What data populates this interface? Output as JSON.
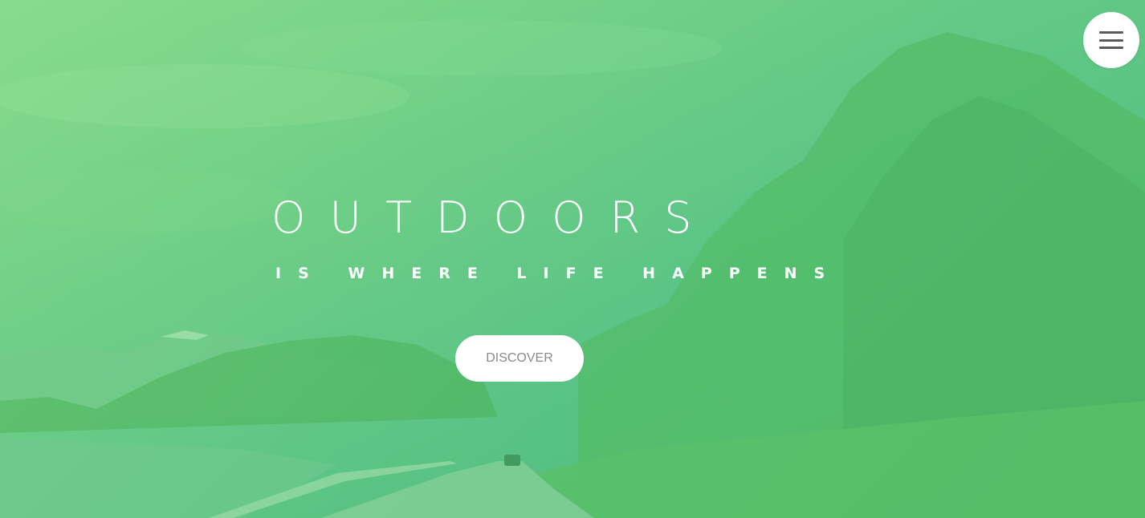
{
  "hero": {
    "title": "OUTDOORS",
    "subtitle": "IS WHERE LIFE HAPPENS",
    "cta_label": "DISCOVER"
  },
  "nav": {
    "menu_icon": "hamburger-menu-icon"
  },
  "colors": {
    "overlay_light": "#86da8c",
    "overlay_dark": "#52b97a",
    "button_bg": "#ffffff",
    "button_text": "#8a8a8a",
    "icon": "#5a5a5a"
  }
}
